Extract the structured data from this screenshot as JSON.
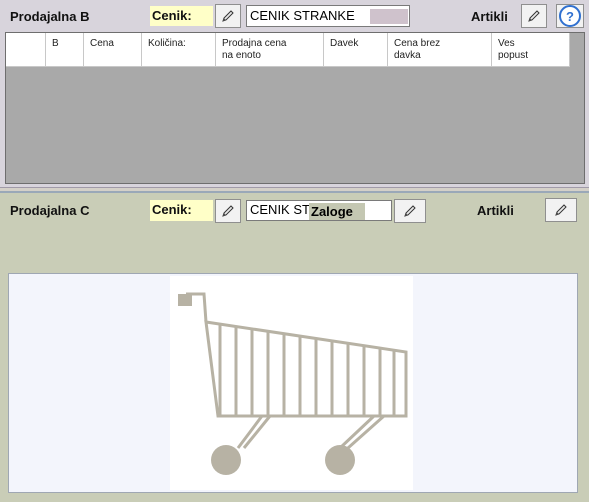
{
  "panel_b": {
    "title": "Prodajalna B",
    "cenik_label": "Cenik:",
    "cenik_value": "CENIK STRANKE",
    "artikli_label": "Artikli",
    "help_label": "?",
    "columns": [
      "",
      "B",
      "Cena",
      "Količina:",
      "Prodajna cena\nna enoto",
      "Davek",
      "Cena brez\ndavka",
      "Ves\npopust"
    ]
  },
  "panel_c": {
    "title": "Prodajalna C",
    "cenik_label": "Cenik:",
    "cenik_value": "CENIK ST",
    "zaloge_label": "Zaloge",
    "artikli_label": "Artikli",
    "image_icon": "shopping-cart-icon"
  },
  "colors": {
    "panel_b_bg": "#d8d4dc",
    "panel_c_bg": "#c9cdb7",
    "cenik_highlight": "#ffffc8",
    "cart_gray": "#b7b2a4",
    "help_blue": "#3070d0"
  }
}
